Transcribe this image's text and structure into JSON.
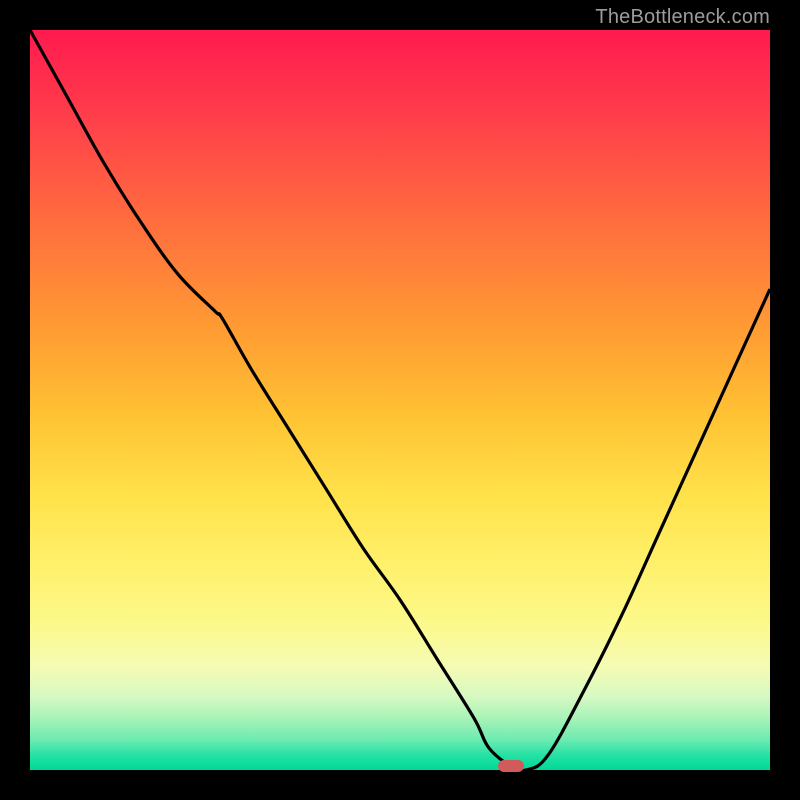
{
  "watermark": "TheBottleneck.com",
  "colors": {
    "frame": "#000000",
    "curve_stroke": "#000000",
    "marker_fill": "#d15a5a",
    "gradient_top": "#ff1a4f",
    "gradient_bottom": "#00d99a"
  },
  "chart_data": {
    "type": "line",
    "title": "",
    "xlabel": "",
    "ylabel": "",
    "xlim": [
      0,
      100
    ],
    "ylim": [
      0,
      100
    ],
    "x": [
      0,
      5,
      10,
      15,
      20,
      25,
      26,
      30,
      35,
      40,
      45,
      50,
      55,
      60,
      62,
      65,
      67,
      70,
      75,
      80,
      85,
      90,
      95,
      100
    ],
    "y": [
      100,
      91,
      82,
      74,
      67,
      62,
      61,
      54,
      46,
      38,
      30,
      23,
      15,
      7,
      3,
      0.5,
      0,
      2,
      11,
      21,
      32,
      43,
      54,
      65
    ],
    "marker": {
      "x": 65,
      "y": 0.5
    }
  }
}
